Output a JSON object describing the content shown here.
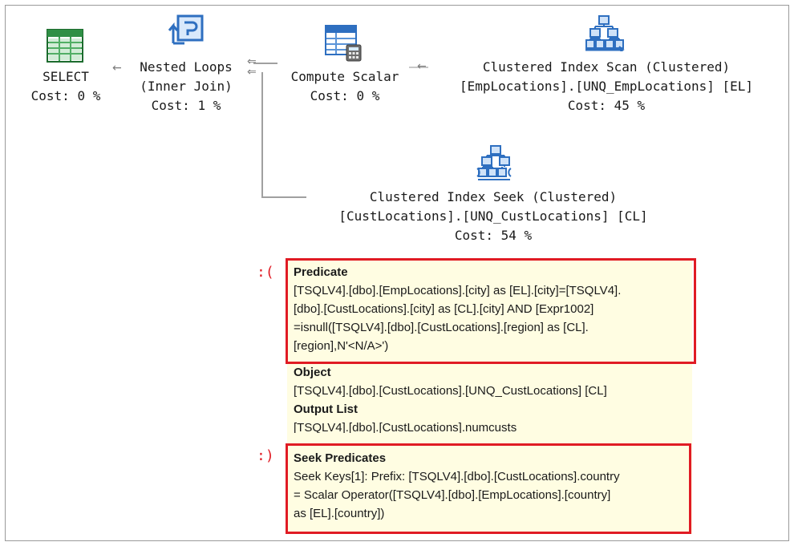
{
  "plan": {
    "select": {
      "line1": "SELECT",
      "line2": "Cost: 0 %"
    },
    "nested_loops": {
      "line1": "Nested Loops",
      "line2": "(Inner Join)",
      "line3": "Cost: 1 %"
    },
    "compute_scalar": {
      "line1": "Compute Scalar",
      "line2": "Cost: 0 %"
    },
    "index_scan": {
      "line1": "Clustered Index Scan (Clustered)",
      "line2": "[EmpLocations].[UNQ_EmpLocations] [EL]",
      "line3": "Cost: 45 %"
    },
    "index_seek": {
      "line1": "Clustered Index Seek (Clustered)",
      "line2": "[CustLocations].[UNQ_CustLocations] [CL]",
      "line3": "Cost: 54 %"
    }
  },
  "tooltip": {
    "predicate_header": "Predicate",
    "predicate_lines": [
      "[TSQLV4].[dbo].[EmpLocations].[city] as [EL].[city]=[TSQLV4].",
      "[dbo].[CustLocations].[city] as [CL].[city] AND [Expr1002]",
      "=isnull([TSQLV4].[dbo].[CustLocations].[region] as [CL].",
      "[region],N'<N/A>')"
    ],
    "object_header": "Object",
    "object_value": "[TSQLV4].[dbo].[CustLocations].[UNQ_CustLocations] [CL]",
    "output_header": "Output List",
    "output_value": "[TSQLV4].[dbo].[CustLocations].numcusts",
    "seek_header": "Seek Predicates",
    "seek_lines": [
      "Seek Keys[1]: Prefix: [TSQLV4].[dbo].[CustLocations].country",
      "= Scalar Operator([TSQLV4].[dbo].[EmpLocations].[country]",
      "as [EL].[country])"
    ]
  },
  "annotations": {
    "sad_face": ":(",
    "happy_face": ":)"
  },
  "colors": {
    "highlight_border": "#e01b24",
    "tooltip_bg": "#fffde2",
    "icon_blue": "#2e6fc0",
    "icon_green": "#3aa050"
  },
  "icons": {
    "select": "select-table-icon",
    "nested_loops": "nested-loops-icon",
    "compute_scalar": "compute-scalar-icon",
    "index_scan": "clustered-index-scan-icon",
    "index_seek": "clustered-index-seek-icon"
  }
}
